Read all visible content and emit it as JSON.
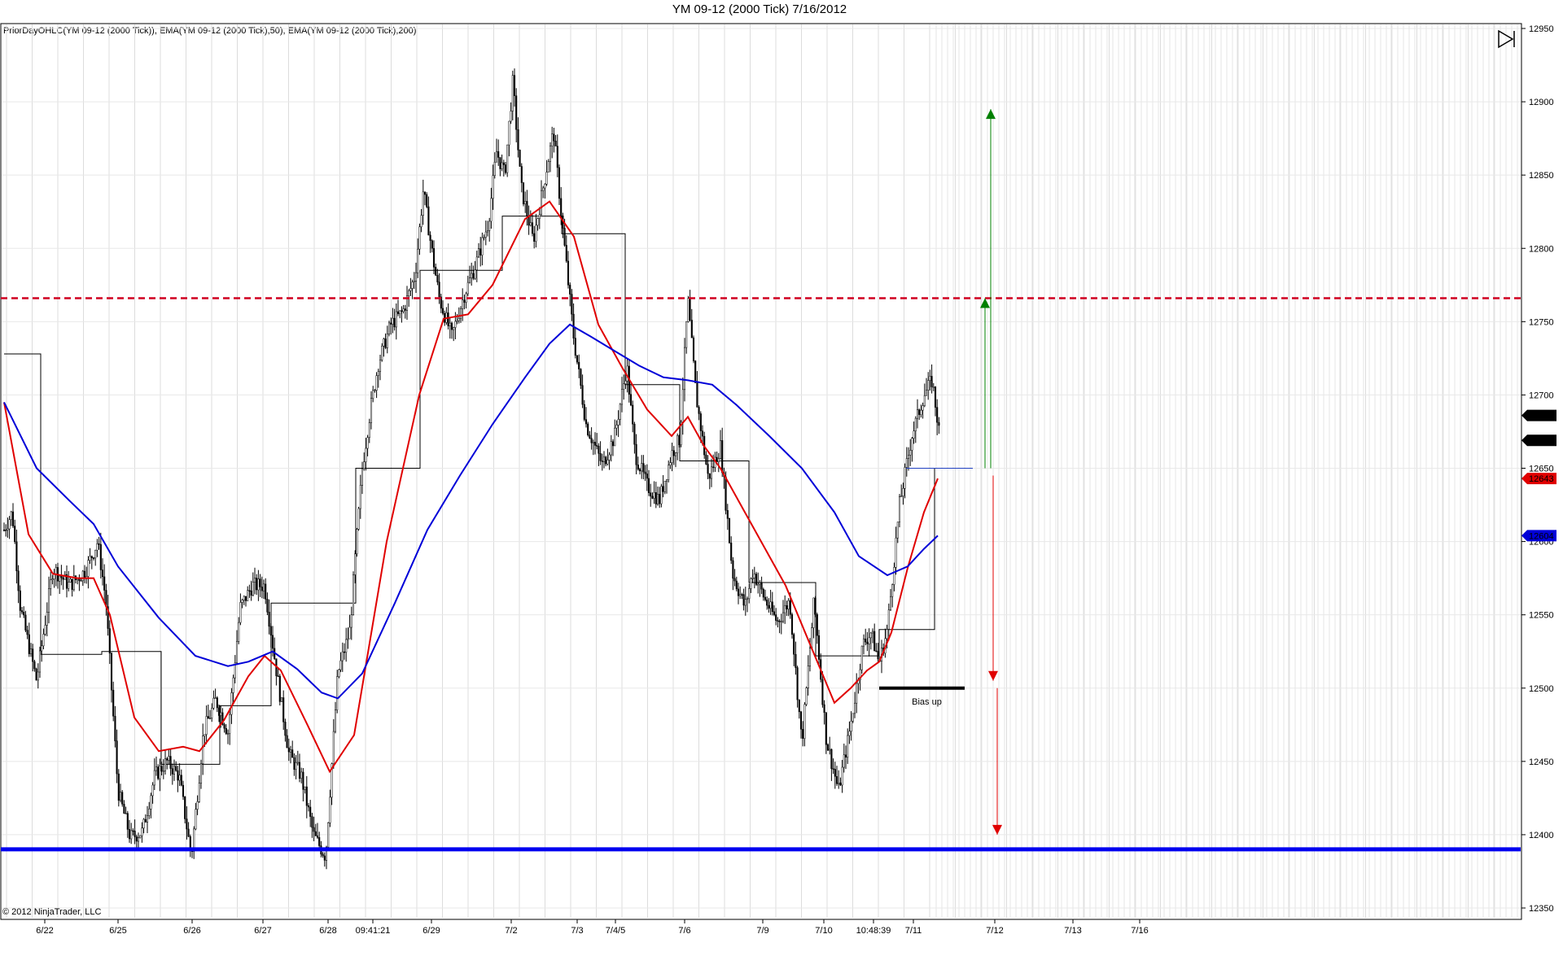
{
  "window": {
    "title": "YM 09-12 (2000 Tick)  7/16/2012",
    "indicator_label": "PriorDayOHLC(YM 09-12 (2000 Tick)), EMA(YM 09-12 (2000 Tick),50), EMA(YM 09-12 (2000 Tick),200)",
    "copyright": "© 2012 NinjaTrader, LLC",
    "play_icon": "play-triangle-icon"
  },
  "colors": {
    "ema50": "#e00000",
    "ema200": "#0000d8",
    "support": "#0000f0",
    "resistance": "#d00020",
    "candle": "#000000",
    "up_arrow": "#008000",
    "down_arrow": "#e00000"
  },
  "chart_data": {
    "type": "line",
    "title": "YM 09-12 (2000 Tick)  7/16/2012",
    "ylim": [
      12350,
      12950
    ],
    "y_ticks": [
      "12950",
      "12900",
      "12850",
      "12800",
      "12750",
      "12700",
      "12650",
      "12600",
      "12550",
      "12500",
      "12450",
      "12400",
      "12350"
    ],
    "x_labels": [
      "6/22",
      "6/25",
      "6/26",
      "6/27",
      "6/28",
      "09:41:21",
      "6/29",
      "7/2",
      "7/3",
      "7/4/5",
      "7/6",
      "7/9",
      "7/10",
      "10:48:39",
      "7/11",
      "7/12",
      "7/13",
      "7/16"
    ],
    "price_markers": [
      {
        "value": 12686,
        "label": "12686"
      },
      {
        "value": 12669,
        "label": "12669"
      },
      {
        "value": 12643,
        "label": "12643"
      },
      {
        "value": 12604,
        "label": "12604"
      }
    ],
    "series": [
      {
        "name": "EMA(YM 09-12 (2000 Tick),50)",
        "points": [
          [
            0,
            12695
          ],
          [
            30,
            12605
          ],
          [
            60,
            12578
          ],
          [
            90,
            12575
          ],
          [
            110,
            12575
          ],
          [
            130,
            12550
          ],
          [
            160,
            12480
          ],
          [
            190,
            12457
          ],
          [
            220,
            12460
          ],
          [
            240,
            12457
          ],
          [
            270,
            12478
          ],
          [
            300,
            12508
          ],
          [
            320,
            12522
          ],
          [
            340,
            12512
          ],
          [
            370,
            12478
          ],
          [
            400,
            12443
          ],
          [
            430,
            12468
          ],
          [
            470,
            12600
          ],
          [
            510,
            12700
          ],
          [
            540,
            12752
          ],
          [
            570,
            12755
          ],
          [
            600,
            12775
          ],
          [
            640,
            12820
          ],
          [
            670,
            12832
          ],
          [
            700,
            12808
          ],
          [
            730,
            12748
          ],
          [
            760,
            12718
          ],
          [
            790,
            12690
          ],
          [
            820,
            12672
          ],
          [
            840,
            12685
          ],
          [
            860,
            12665
          ],
          [
            880,
            12650
          ],
          [
            910,
            12620
          ],
          [
            940,
            12590
          ],
          [
            960,
            12570
          ],
          [
            990,
            12530
          ],
          [
            1020,
            12490
          ],
          [
            1040,
            12500
          ],
          [
            1060,
            12512
          ],
          [
            1075,
            12518
          ],
          [
            1090,
            12538
          ],
          [
            1110,
            12582
          ],
          [
            1130,
            12620
          ],
          [
            1147,
            12643
          ]
        ]
      },
      {
        "name": "EMA(YM 09-12 (2000 Tick),200)",
        "points": [
          [
            0,
            12695
          ],
          [
            40,
            12650
          ],
          [
            80,
            12628
          ],
          [
            110,
            12612
          ],
          [
            140,
            12583
          ],
          [
            190,
            12548
          ],
          [
            235,
            12522
          ],
          [
            275,
            12515
          ],
          [
            300,
            12518
          ],
          [
            330,
            12525
          ],
          [
            360,
            12513
          ],
          [
            390,
            12497
          ],
          [
            410,
            12493
          ],
          [
            440,
            12510
          ],
          [
            480,
            12558
          ],
          [
            520,
            12608
          ],
          [
            560,
            12645
          ],
          [
            600,
            12680
          ],
          [
            640,
            12712
          ],
          [
            670,
            12735
          ],
          [
            695,
            12748
          ],
          [
            720,
            12740
          ],
          [
            750,
            12730
          ],
          [
            780,
            12720
          ],
          [
            810,
            12712
          ],
          [
            840,
            12710
          ],
          [
            870,
            12707
          ],
          [
            900,
            12693
          ],
          [
            940,
            12672
          ],
          [
            980,
            12650
          ],
          [
            1020,
            12620
          ],
          [
            1050,
            12590
          ],
          [
            1085,
            12577
          ],
          [
            1110,
            12583
          ],
          [
            1130,
            12595
          ],
          [
            1147,
            12604
          ]
        ]
      }
    ],
    "price_path": [
      [
        0,
        12608
      ],
      [
        10,
        12620
      ],
      [
        20,
        12555
      ],
      [
        40,
        12505
      ],
      [
        60,
        12582
      ],
      [
        80,
        12570
      ],
      [
        100,
        12580
      ],
      [
        115,
        12600
      ],
      [
        125,
        12560
      ],
      [
        140,
        12430
      ],
      [
        155,
        12398
      ],
      [
        170,
        12402
      ],
      [
        185,
        12440
      ],
      [
        200,
        12450
      ],
      [
        215,
        12440
      ],
      [
        230,
        12385
      ],
      [
        245,
        12470
      ],
      [
        260,
        12492
      ],
      [
        275,
        12470
      ],
      [
        290,
        12555
      ],
      [
        305,
        12570
      ],
      [
        320,
        12570
      ],
      [
        335,
        12510
      ],
      [
        350,
        12455
      ],
      [
        365,
        12440
      ],
      [
        380,
        12400
      ],
      [
        395,
        12385
      ],
      [
        410,
        12510
      ],
      [
        425,
        12540
      ],
      [
        430,
        12580
      ],
      [
        440,
        12650
      ],
      [
        450,
        12690
      ],
      [
        460,
        12722
      ],
      [
        475,
        12748
      ],
      [
        490,
        12757
      ],
      [
        505,
        12782
      ],
      [
        515,
        12840
      ],
      [
        525,
        12800
      ],
      [
        535,
        12765
      ],
      [
        550,
        12740
      ],
      [
        565,
        12768
      ],
      [
        580,
        12790
      ],
      [
        595,
        12818
      ],
      [
        605,
        12866
      ],
      [
        615,
        12850
      ],
      [
        625,
        12914
      ],
      [
        635,
        12842
      ],
      [
        650,
        12805
      ],
      [
        665,
        12850
      ],
      [
        675,
        12880
      ],
      [
        685,
        12820
      ],
      [
        700,
        12738
      ],
      [
        715,
        12680
      ],
      [
        735,
        12652
      ],
      [
        750,
        12672
      ],
      [
        765,
        12720
      ],
      [
        775,
        12660
      ],
      [
        790,
        12638
      ],
      [
        805,
        12628
      ],
      [
        820,
        12660
      ],
      [
        830,
        12670
      ],
      [
        840,
        12765
      ],
      [
        850,
        12700
      ],
      [
        865,
        12643
      ],
      [
        880,
        12665
      ],
      [
        895,
        12578
      ],
      [
        910,
        12555
      ],
      [
        920,
        12580
      ],
      [
        935,
        12560
      ],
      [
        950,
        12545
      ],
      [
        965,
        12560
      ],
      [
        980,
        12462
      ],
      [
        995,
        12560
      ],
      [
        1010,
        12465
      ],
      [
        1025,
        12430
      ],
      [
        1040,
        12475
      ],
      [
        1055,
        12530
      ],
      [
        1065,
        12538
      ],
      [
        1075,
        12517
      ],
      [
        1085,
        12540
      ],
      [
        1100,
        12625
      ],
      [
        1115,
        12672
      ],
      [
        1130,
        12700
      ],
      [
        1140,
        12710
      ],
      [
        1150,
        12669
      ]
    ],
    "candle_wick_range": 11,
    "support_line": 12390,
    "resistance_line": 12766,
    "prior_day_steps": [
      [
        0,
        12728
      ],
      [
        45,
        12728
      ],
      [
        45,
        12523
      ],
      [
        120,
        12523
      ],
      [
        120,
        12525
      ],
      [
        193,
        12525
      ],
      [
        193,
        12448
      ],
      [
        265,
        12448
      ],
      [
        265,
        12488
      ],
      [
        328,
        12488
      ],
      [
        328,
        12558
      ],
      [
        432,
        12558
      ],
      [
        432,
        12650
      ],
      [
        511,
        12650
      ],
      [
        511,
        12785
      ],
      [
        612,
        12785
      ],
      [
        612,
        12822
      ],
      [
        685,
        12822
      ],
      [
        685,
        12810
      ],
      [
        763,
        12810
      ],
      [
        763,
        12707
      ],
      [
        830,
        12707
      ],
      [
        830,
        12655
      ],
      [
        915,
        12655
      ],
      [
        915,
        12572
      ],
      [
        997,
        12572
      ],
      [
        997,
        12522
      ],
      [
        1075,
        12522
      ],
      [
        1075,
        12540
      ],
      [
        1143,
        12540
      ],
      [
        1143,
        12650
      ]
    ],
    "bias_line": {
      "x1": 1075,
      "x2": 1180,
      "value": 12500,
      "label": "Bias up"
    },
    "short_line": {
      "x1": 1108,
      "x2": 1190,
      "value": 12650
    },
    "arrows": [
      {
        "x": 1212,
        "from": 12650,
        "to": 12895,
        "dir": "up"
      },
      {
        "x": 1205,
        "from": 12650,
        "to": 12766,
        "dir": "up"
      },
      {
        "x": 1215,
        "from": 12645,
        "to": 12505,
        "dir": "down"
      },
      {
        "x": 1220,
        "from": 12500,
        "to": 12400,
        "dir": "down"
      }
    ]
  }
}
